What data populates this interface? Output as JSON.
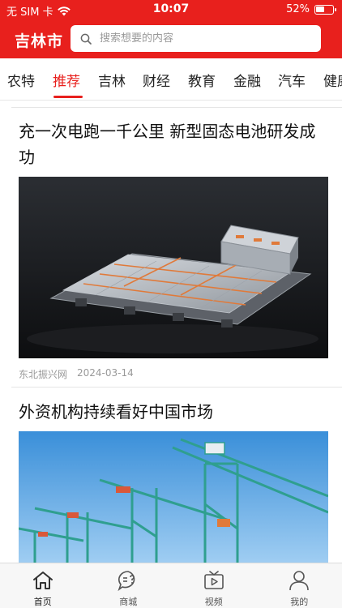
{
  "status_bar": {
    "carrier": "无 SIM 卡",
    "time": "10:07",
    "battery": "52%",
    "battery_level": 0.52
  },
  "header": {
    "city": "吉林市",
    "search_placeholder": "搜索想要的内容"
  },
  "tabs": [
    {
      "label": "农特"
    },
    {
      "label": "推荐",
      "active": true
    },
    {
      "label": "吉林"
    },
    {
      "label": "财经"
    },
    {
      "label": "教育"
    },
    {
      "label": "金融"
    },
    {
      "label": "汽车"
    },
    {
      "label": "健康"
    }
  ],
  "articles": [
    {
      "title": "充一次电跑一千公里 新型固态电池研发成功",
      "source": "东北振兴网",
      "date": "2024-03-14"
    },
    {
      "title": "外资机构持续看好中国市场"
    }
  ],
  "tabbar": [
    {
      "label": "首页",
      "icon": "home-icon",
      "active": true
    },
    {
      "label": "商城",
      "icon": "chat-question-icon"
    },
    {
      "label": "视频",
      "icon": "tv-icon"
    },
    {
      "label": "我的",
      "icon": "person-icon"
    }
  ],
  "colors": {
    "brand_red": "#e8201d",
    "text_dark": "#111111",
    "meta_gray": "#999999"
  }
}
